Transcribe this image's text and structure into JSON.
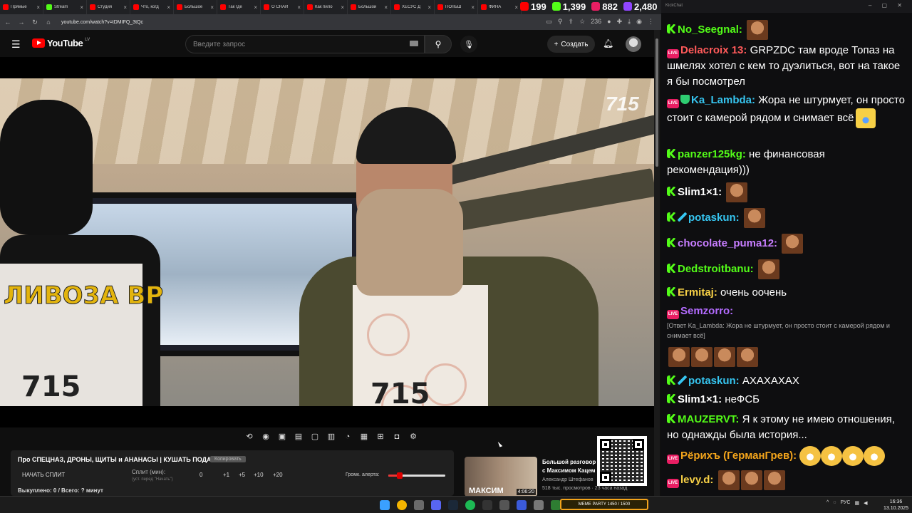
{
  "browser": {
    "tabs": [
      {
        "label": "Прямые",
        "color": "#ff0000"
      },
      {
        "label": "Stream",
        "color": "#53fc18"
      },
      {
        "label": "Студия",
        "color": "#ff0000"
      },
      {
        "label": "Что, когд",
        "color": "#ff0000"
      },
      {
        "label": "Большое",
        "color": "#ff0000"
      },
      {
        "label": "Так где",
        "color": "#ff0000"
      },
      {
        "label": "О СНАЙ",
        "color": "#ff0000"
      },
      {
        "label": "Как пило",
        "color": "#ff0000"
      },
      {
        "label": "Большой",
        "color": "#ff0000"
      },
      {
        "label": "ХЕСУС Д",
        "color": "#ff0000"
      },
      {
        "label": "ПОЛЬШ",
        "color": "#ff0000"
      },
      {
        "label": "ФИНА",
        "color": "#ff0000"
      }
    ],
    "url": "youtube.com/watch?v=tDMIFQ_3tQc",
    "badge_count": "236"
  },
  "counters": [
    {
      "value": "199",
      "color": "#ff0000"
    },
    {
      "value": "1,399",
      "color": "#53fc18"
    },
    {
      "value": "882",
      "color": "#e91e63"
    },
    {
      "value": "2,480",
      "color": "#9146ff"
    }
  ],
  "youtube": {
    "logo_text": "YouTube",
    "region": "LV",
    "search_placeholder": "Введите запрос",
    "create_label": "Создать",
    "video_watermark": "715",
    "apron_text": "ЛИВО3А ВР",
    "apron_num_1": "715",
    "apron_num_2": "715"
  },
  "panel": {
    "title": "Про СПЕЦНАЗ, ДРОНЫ, ЩИТЫ и АНАНАСЫ | КУШАТЬ ПОДАНО!",
    "copy_label": "Копировать",
    "split_start": "НАЧАТЬ СПЛИТ",
    "split_label": "Сплит (мин):",
    "split_hint": "(уст. перед \"Начать\")",
    "split_value": "0",
    "split_steps": [
      "+1",
      "+5",
      "+10",
      "+20"
    ],
    "volume_label": "Громк. алерта:",
    "volume_level": 0.2,
    "totals": "Выкуплено: 0 / Всего: ? минут"
  },
  "recommended": {
    "thumb_text": "МАКСИМ",
    "duration": "4:06:20",
    "title": "Большой разговор с Максимом Кацем",
    "channel": "Александр Штефанов",
    "views": "518 тыс. просмотров · 23 часа назад"
  },
  "chat": {
    "header": "KickChat",
    "messages": [
      {
        "badges": [
          "k"
        ],
        "user": "No_Seegnal:",
        "color": "#53fc18",
        "text": "",
        "emotes": 1
      },
      {
        "badges": [
          "live"
        ],
        "user": "Delacroix 13:",
        "color": "#ff5a5a",
        "text": "GRPZDC там вроде Топаз на шмелях хотел с кем то дуэлиться, вот на такое я бы посмотрел"
      },
      {
        "badges": [
          "live",
          "shield"
        ],
        "user": "Ka_Lambda:",
        "color": "#36c5f0",
        "text": "Жора не штурмует, он просто стоит с камерой рядом и снимает всё"
      },
      {
        "badges": [
          "k"
        ],
        "user": "panzer125kg:",
        "color": "#53fc18",
        "text": "не финансовая рекомендация)))"
      },
      {
        "badges": [
          "k"
        ],
        "user": "Slim1×1:",
        "color": "#ffffff",
        "text": "",
        "emotes": 1
      },
      {
        "badges": [
          "k",
          "sword"
        ],
        "user": "potaskun:",
        "color": "#36c5f0",
        "text": "",
        "emotes": 1
      },
      {
        "badges": [
          "k"
        ],
        "user": "chocolate_puma12:",
        "color": "#c77dff",
        "text": "",
        "emotes": 1
      },
      {
        "badges": [
          "k"
        ],
        "user": "Dedstroitbanu:",
        "color": "#53fc18",
        "text": "",
        "emotes": 1
      },
      {
        "badges": [
          "k"
        ],
        "user": "Ermitaj:",
        "color": "#f7d046",
        "text": "очень оочень"
      },
      {
        "badges": [
          "live"
        ],
        "user": "Semzorro:",
        "color": "#b36bff",
        "text": ""
      },
      {
        "reply": "[Ответ Ka_Lambda: Жора не штурмует, он просто стоит с камерой рядом и снимает всё]"
      },
      {
        "badges": [
          "k",
          "sword"
        ],
        "user": "potaskun:",
        "color": "#36c5f0",
        "text": "АХАХАХАХ"
      },
      {
        "badges": [
          "k"
        ],
        "user": "Slim1×1:",
        "color": "#ffffff",
        "text": "неФСБ"
      },
      {
        "badges": [
          "k"
        ],
        "user": "MAUZERVT:",
        "color": "#53fc18",
        "text": "Я к этому не имею отношения, но однажды была история..."
      },
      {
        "badges": [
          "live"
        ],
        "user": "Рёрихъ (ГерманГрев):",
        "color": "#f3a41b",
        "text": "",
        "emotes": 4
      },
      {
        "badges": [
          "live"
        ],
        "user": "levy.d:",
        "color": "#f7d046",
        "text": "",
        "emotes": 3
      }
    ]
  },
  "taskbar": {
    "meme_label": "MEME PARTY",
    "meme_progress": "1450 / 1500",
    "lang": "РУС",
    "time": "16:36",
    "date": "13.10.2025"
  }
}
